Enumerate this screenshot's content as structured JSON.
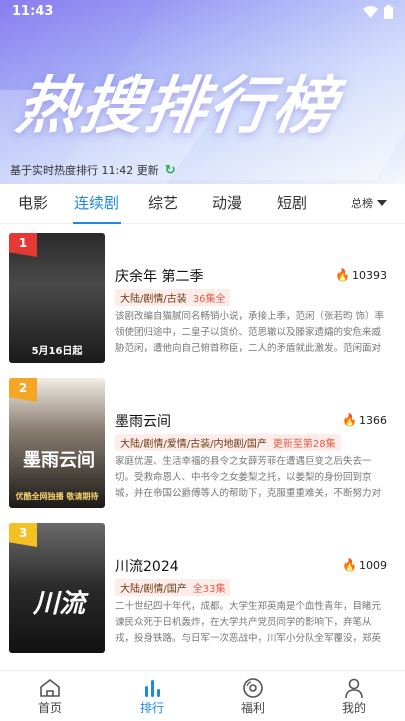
{
  "status": {
    "time": "11:43"
  },
  "hero": {
    "title": "热搜排行榜"
  },
  "update": {
    "text": "基于实时热度排行 11:42 更新"
  },
  "tabs": [
    {
      "label": "电影"
    },
    {
      "label": "连续剧",
      "active": true
    },
    {
      "label": "综艺"
    },
    {
      "label": "动漫"
    },
    {
      "label": "短剧"
    }
  ],
  "sort": {
    "label": "总榜"
  },
  "items": [
    {
      "rank": "1",
      "rank_color": "#e53935",
      "title": "庆余年 第二季",
      "heat": "10393",
      "genre": "大陆/剧情/古装",
      "episodes": "36集全",
      "description": "该剧改编自猫腻同名畅销小说，承接上季，范闲（张若昀 饰）率领使团归途中，二皇子以货价、范思辙以及滕家遗孀的安危来威胁范闲，遭他向自己俯首称臣，二人的矛盾就此激发。范闲面对对他的构...",
      "poster_text": "5月16日起"
    },
    {
      "rank": "2",
      "rank_color": "#f5a623",
      "title": "墨雨云间",
      "heat": "1366",
      "genre": "大陆/剧情/爱情/古装/内地剧/国产",
      "episodes": "更新至第28集",
      "description": "家庭优渥、生活幸福的县令之女薛芳菲在遭遇巨变之后失去一切。受救命恩人、中书令之女姜梨之托，以姜梨的身份回到京城，并在帝国公爵傅等人的帮助下，克服重重难关，不断努力对抗不公，最终救...",
      "poster_text": "墨雨云间",
      "poster_sub": "优酷全网独播 敬请期待"
    },
    {
      "rank": "3",
      "rank_color": "#f5c023",
      "title": "川流2024",
      "heat": "1009",
      "genre": "大陆/剧情/国产",
      "episodes": "全33集",
      "description": "二十世纪四十年代，成都。大学生郑英南是个血性青年，目睹元谏民众死于日机轰炸，在大学共产党员同学的影响下，弃笔从戎，投身铁路。与日军一次恶战中，川军小分队全军覆没，郑英南和八路军狭...",
      "poster_text": "川流"
    }
  ],
  "nav": [
    {
      "label": "首页",
      "icon": "home-icon"
    },
    {
      "label": "排行",
      "icon": "ranking-icon",
      "active": true
    },
    {
      "label": "福利",
      "icon": "gift-disc-icon"
    },
    {
      "label": "我的",
      "icon": "profile-icon"
    }
  ]
}
